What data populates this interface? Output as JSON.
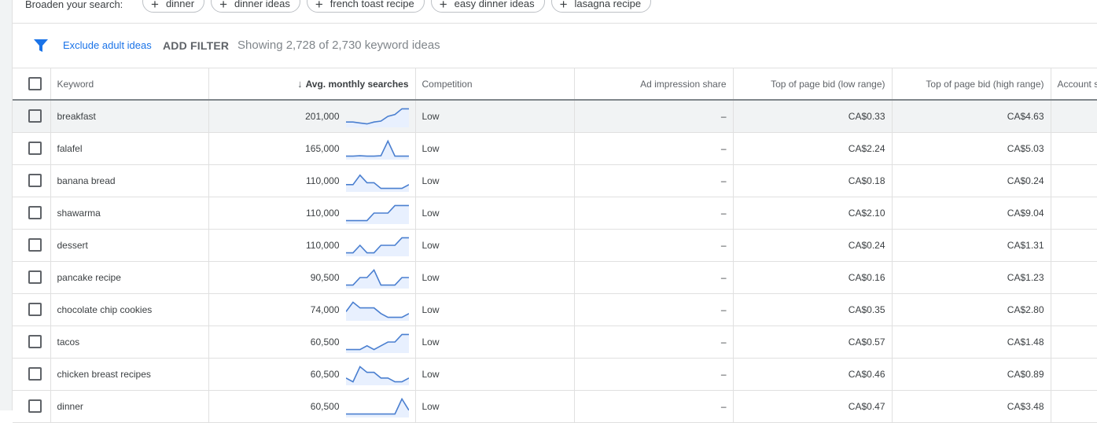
{
  "broaden": {
    "label": "Broaden your search:",
    "chips": [
      "dinner",
      "dinner ideas",
      "french toast recipe",
      "easy dinner ideas",
      "lasagna recipe"
    ]
  },
  "filterbar": {
    "exclude_label": "Exclude adult ideas",
    "add_filter_label": "ADD FILTER",
    "showing_text": "Showing 2,728 of 2,730 keyword ideas"
  },
  "table": {
    "headers": {
      "keyword": "Keyword",
      "searches": "Avg. monthly searches",
      "competition": "Competition",
      "impression": "Ad impression share",
      "bid_low": "Top of page bid (low range)",
      "bid_high": "Top of page bid (high range)",
      "account": "Account s"
    },
    "rows": [
      {
        "keyword": "breakfast",
        "searches": "201,000",
        "competition": "Low",
        "impression": "–",
        "bid_low": "CA$0.33",
        "bid_high": "CA$4.63",
        "trend": [
          0.2,
          0.2,
          0.15,
          0.1,
          0.2,
          0.25,
          0.5,
          0.6,
          0.9,
          0.9
        ]
      },
      {
        "keyword": "falafel",
        "searches": "165,000",
        "competition": "Low",
        "impression": "–",
        "bid_low": "CA$2.24",
        "bid_high": "CA$5.03",
        "trend": [
          0.1,
          0.1,
          0.12,
          0.1,
          0.1,
          0.12,
          0.9,
          0.1,
          0.1,
          0.1
        ]
      },
      {
        "keyword": "banana bread",
        "searches": "110,000",
        "competition": "Low",
        "impression": "–",
        "bid_low": "CA$0.18",
        "bid_high": "CA$0.24",
        "trend": [
          0.3,
          0.3,
          0.8,
          0.4,
          0.4,
          0.1,
          0.1,
          0.1,
          0.1,
          0.3
        ]
      },
      {
        "keyword": "shawarma",
        "searches": "110,000",
        "competition": "Low",
        "impression": "–",
        "bid_low": "CA$2.10",
        "bid_high": "CA$9.04",
        "trend": [
          0.1,
          0.1,
          0.1,
          0.1,
          0.5,
          0.5,
          0.5,
          0.9,
          0.9,
          0.9
        ]
      },
      {
        "keyword": "dessert",
        "searches": "110,000",
        "competition": "Low",
        "impression": "–",
        "bid_low": "CA$0.24",
        "bid_high": "CA$1.31",
        "trend": [
          0.1,
          0.1,
          0.5,
          0.1,
          0.1,
          0.5,
          0.5,
          0.5,
          0.9,
          0.9
        ]
      },
      {
        "keyword": "pancake recipe",
        "searches": "90,500",
        "competition": "Low",
        "impression": "–",
        "bid_low": "CA$0.16",
        "bid_high": "CA$1.23",
        "trend": [
          0.1,
          0.1,
          0.5,
          0.5,
          0.9,
          0.1,
          0.1,
          0.1,
          0.5,
          0.5
        ]
      },
      {
        "keyword": "chocolate chip cookies",
        "searches": "74,000",
        "competition": "Low",
        "impression": "–",
        "bid_low": "CA$0.35",
        "bid_high": "CA$2.80",
        "trend": [
          0.4,
          0.9,
          0.6,
          0.6,
          0.6,
          0.3,
          0.1,
          0.1,
          0.1,
          0.3
        ]
      },
      {
        "keyword": "tacos",
        "searches": "60,500",
        "competition": "Low",
        "impression": "–",
        "bid_low": "CA$0.57",
        "bid_high": "CA$1.48",
        "trend": [
          0.1,
          0.1,
          0.1,
          0.3,
          0.1,
          0.3,
          0.5,
          0.5,
          0.9,
          0.9
        ]
      },
      {
        "keyword": "chicken breast recipes",
        "searches": "60,500",
        "competition": "Low",
        "impression": "–",
        "bid_low": "CA$0.46",
        "bid_high": "CA$0.89",
        "trend": [
          0.3,
          0.1,
          0.9,
          0.6,
          0.6,
          0.3,
          0.3,
          0.1,
          0.1,
          0.3
        ]
      },
      {
        "keyword": "dinner",
        "searches": "60,500",
        "competition": "Low",
        "impression": "–",
        "bid_low": "CA$0.47",
        "bid_high": "CA$3.48",
        "trend": [
          0.1,
          0.1,
          0.1,
          0.1,
          0.1,
          0.1,
          0.1,
          0.1,
          0.9,
          0.3
        ]
      }
    ]
  }
}
